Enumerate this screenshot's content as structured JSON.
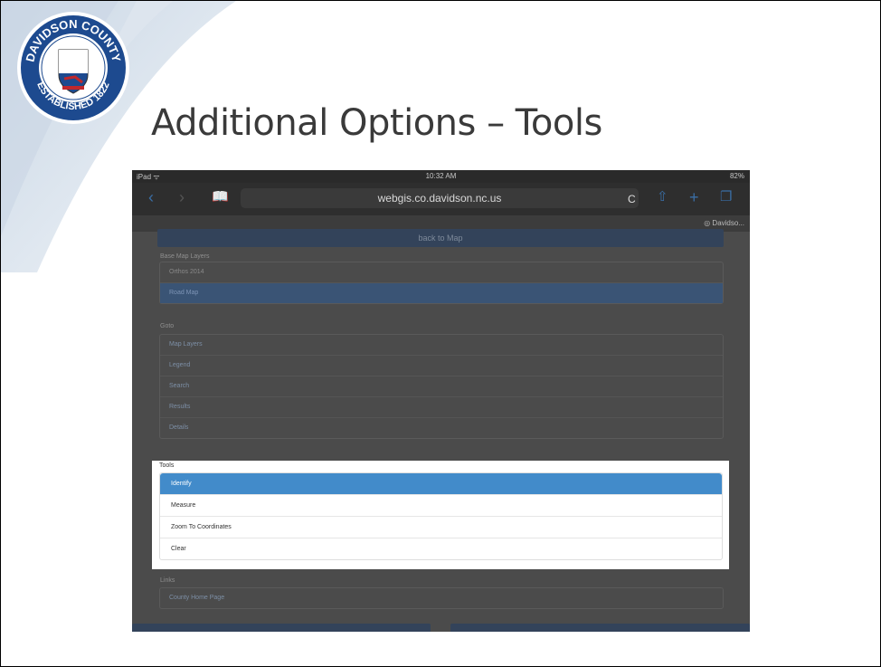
{
  "slide": {
    "title": "Additional Options – Tools",
    "seal_text": "DAVIDSON COUNTY ESTABLISHED 1822"
  },
  "ipad": {
    "status": {
      "carrier": "iPad ᯤ",
      "time": "10:32 AM",
      "battery": "82%"
    },
    "url": "webgis.co.davidson.nc.us",
    "tab_label": "Davidso...",
    "back_label": "back to Map",
    "base_layers": {
      "label": "Base Map Layers",
      "items": [
        "Orthos 2014",
        "Road Map"
      ],
      "selected": "Road Map"
    },
    "goto": {
      "label": "Goto",
      "items": [
        "Map Layers",
        "Legend",
        "Search",
        "Results",
        "Details"
      ]
    },
    "tools": {
      "label": "Tools",
      "items": [
        "Identify",
        "Measure",
        "Zoom To Coordinates",
        "Clear"
      ],
      "selected": "Identify"
    },
    "links": {
      "label": "Links",
      "items": [
        "County Home Page"
      ]
    }
  },
  "colors": {
    "accent": "#428bca",
    "overlay": "#4b4b4b",
    "title_text": "#3a3a3a"
  }
}
